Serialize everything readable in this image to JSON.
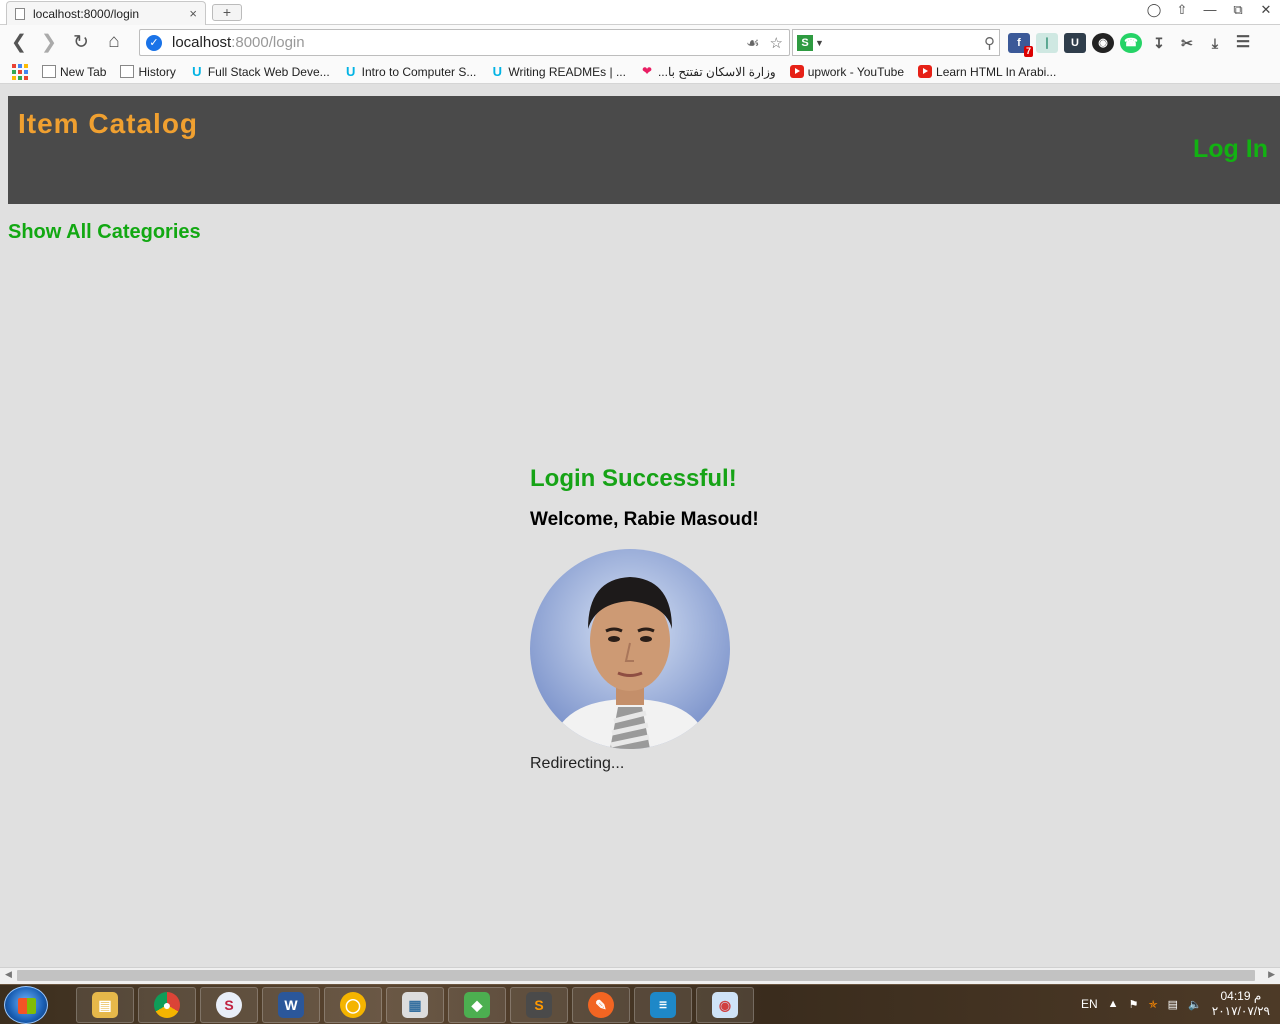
{
  "browser": {
    "tab_title": "localhost:8000/login",
    "tab_close": "×",
    "new_tab": "+",
    "url_host": "localhost",
    "url_rest": ":8000/login",
    "bookmarks": [
      {
        "label": "New Tab",
        "icon": "page-icon"
      },
      {
        "label": "History",
        "icon": "page-icon"
      },
      {
        "label": "Full Stack Web Deve...",
        "icon": "udacity-icon"
      },
      {
        "label": "Intro to Computer S...",
        "icon": "udacity-icon"
      },
      {
        "label": "Writing READMEs | ...",
        "icon": "udacity-icon"
      },
      {
        "label": "...وزارة الاسكان تفتتح با",
        "icon": "pin-icon"
      },
      {
        "label": "upwork - YouTube",
        "icon": "youtube-icon"
      },
      {
        "label": "Learn HTML In Arabi...",
        "icon": "youtube-icon"
      }
    ],
    "extension_badge": "7"
  },
  "header": {
    "title": "Item Catalog",
    "login_label": "Log In"
  },
  "nav": {
    "show_all": "Show All Categories"
  },
  "result": {
    "success": "Login Successful!",
    "welcome": "Welcome, Rabie Masoud!",
    "redirect": "Redirecting..."
  },
  "taskbar": {
    "lang": "EN",
    "time": "04:19 م",
    "date": "٢٠١٧/٠٧/٢٩"
  },
  "colors": {
    "header_bg": "#4a4a4a",
    "title": "#f0a030",
    "accent_green": "#12a812",
    "page_bg": "#e0e0e0"
  }
}
